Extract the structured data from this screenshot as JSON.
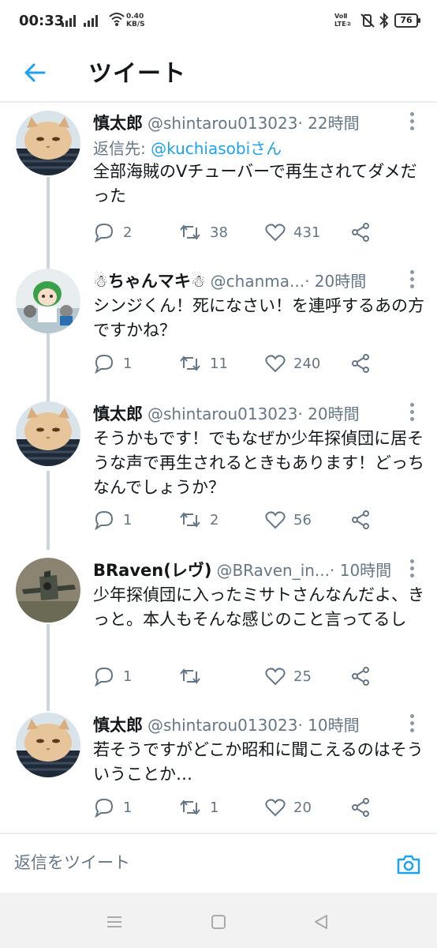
{
  "status_bar": {
    "time": "00:33",
    "net_speed_value": "0.40",
    "net_speed_unit": "KB/S",
    "volte_line1": "VoⅡ",
    "volte_line2": "LTE②",
    "battery": "76"
  },
  "header": {
    "title": "ツイート",
    "back_icon": "arrow-left-icon",
    "accent_color": "#1da1f2"
  },
  "tweets": [
    {
      "name": "慎太郎",
      "handle": "@shintarou013023",
      "time": " · 22時間",
      "reply_to_label": "返信先: ",
      "reply_to_mention": "@kuchiasobiさん",
      "text": "全部海賊のVチューバーで再生されてダメだった",
      "replies": "2",
      "retweets": "38",
      "likes": "431"
    },
    {
      "name": "☃ちゃんマキ☃",
      "handle": "@chanma...",
      "time": " · 20時間",
      "text": "シンジくん！死になさい！を連呼するあの方ですかね？",
      "replies": "1",
      "retweets": "11",
      "likes": "240"
    },
    {
      "name": "慎太郎",
      "handle": "@shintarou013023",
      "time": " · 20時間",
      "text": "そうかもです！でもなぜか少年探偵団に居そうな声で再生されるときもあります！どっちなんでしょうか？",
      "replies": "1",
      "retweets": "2",
      "likes": "56"
    },
    {
      "name": "BRaven(レヴ)",
      "handle": "@BRaven_in...",
      "time": " · 10時間",
      "text": "少年探偵団に入ったミサトさんなんだよ、きっと。本人もそんな感じのこと言ってるし",
      "replies": "1",
      "retweets": "",
      "likes": "25"
    },
    {
      "name": "慎太郎",
      "handle": "@shintarou013023",
      "time": " · 10時間",
      "text": "若そうですがどこか昭和に聞こえるのはそういうことか…",
      "replies": "1",
      "retweets": "1",
      "likes": "20"
    }
  ],
  "reply_bar": {
    "placeholder": "返信をツイート",
    "camera_icon": "camera-icon"
  },
  "nav_bar": {
    "icons": [
      "menu-icon",
      "home-square-icon",
      "back-triangle-icon"
    ]
  }
}
